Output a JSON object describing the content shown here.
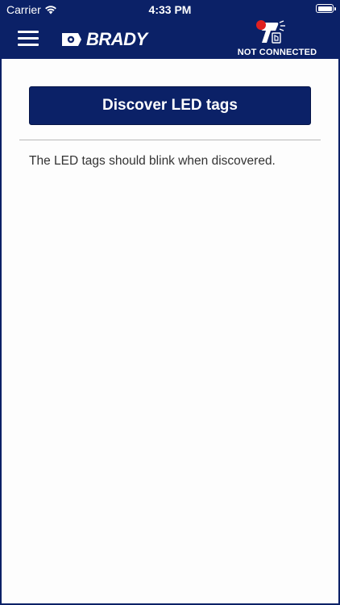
{
  "status_bar": {
    "carrier": "Carrier",
    "time": "4:33 PM"
  },
  "header": {
    "brand": "BRADY",
    "connection_status": "NOT CONNECTED"
  },
  "main": {
    "discover_button_label": "Discover LED tags",
    "hint": "The LED tags should blink when discovered."
  },
  "colors": {
    "header_bg": "#0b2167",
    "content_bg": "#fdfdfd",
    "button_bg": "#0b2167",
    "status_dot": "#e02020"
  },
  "icons": {
    "menu": "hamburger-menu-icon",
    "brand": "brady-logo-mark",
    "scanner": "rfid-scanner-icon",
    "wifi": "wifi-icon",
    "battery": "battery-icon"
  }
}
